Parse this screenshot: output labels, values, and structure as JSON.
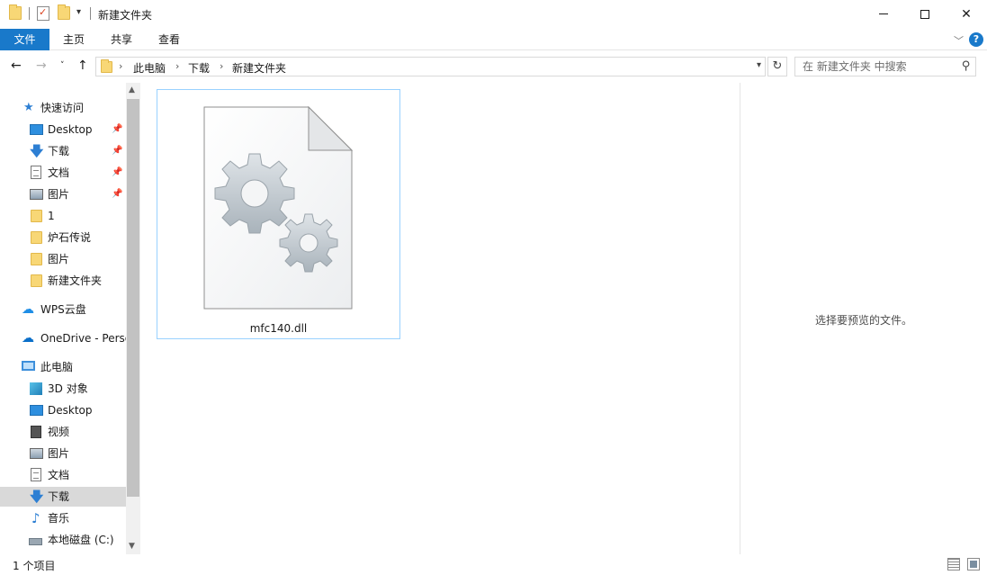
{
  "window": {
    "title": "新建文件夹",
    "close_glyph": "✕"
  },
  "ribbon": {
    "tabs": [
      "文件",
      "主页",
      "共享",
      "查看"
    ],
    "help_glyph": "?"
  },
  "address": {
    "crumbs": [
      "此电脑",
      "下载",
      "新建文件夹"
    ],
    "search_placeholder": "在 新建文件夹 中搜索"
  },
  "nav_pane": {
    "items": [
      {
        "label": "快速访问",
        "icon": "star-icon",
        "pinned": false
      },
      {
        "label": "Desktop",
        "icon": "desktop-icon",
        "pinned": true
      },
      {
        "label": "下载",
        "icon": "download-icon",
        "pinned": true
      },
      {
        "label": "文档",
        "icon": "document-icon",
        "pinned": true
      },
      {
        "label": "图片",
        "icon": "pictures-icon",
        "pinned": true
      },
      {
        "label": "1",
        "icon": "folder-icon",
        "pinned": false
      },
      {
        "label": "炉石传说",
        "icon": "folder-icon",
        "pinned": false
      },
      {
        "label": "图片",
        "icon": "folder-icon",
        "pinned": false
      },
      {
        "label": "新建文件夹",
        "icon": "folder-icon",
        "pinned": false
      },
      {
        "label": "WPS云盘",
        "icon": "cloud-icon",
        "pinned": false
      },
      {
        "label": "OneDrive - Personal",
        "icon": "onedrive-icon",
        "pinned": false
      },
      {
        "label": "此电脑",
        "icon": "computer-icon",
        "pinned": false
      },
      {
        "label": "3D 对象",
        "icon": "3d-objects-icon",
        "pinned": false
      },
      {
        "label": "Desktop",
        "icon": "desktop-icon",
        "pinned": false
      },
      {
        "label": "视频",
        "icon": "video-icon",
        "pinned": false
      },
      {
        "label": "图片",
        "icon": "pictures-icon",
        "pinned": false
      },
      {
        "label": "文档",
        "icon": "document-icon",
        "pinned": false
      },
      {
        "label": "下载",
        "icon": "download-icon",
        "pinned": false,
        "selected": true
      },
      {
        "label": "音乐",
        "icon": "music-icon",
        "pinned": false
      },
      {
        "label": "本地磁盘 (C:)",
        "icon": "drive-icon",
        "pinned": false
      }
    ]
  },
  "content": {
    "files": [
      {
        "name": "mfc140.dll",
        "icon": "dll-file-icon",
        "selected": true
      }
    ]
  },
  "preview": {
    "message": "选择要预览的文件。"
  },
  "status": {
    "item_count": "1 个项目"
  },
  "colors": {
    "accent": "#1979ca",
    "selection_border": "#99d1ff",
    "nav_selected": "#d9d9d9"
  }
}
